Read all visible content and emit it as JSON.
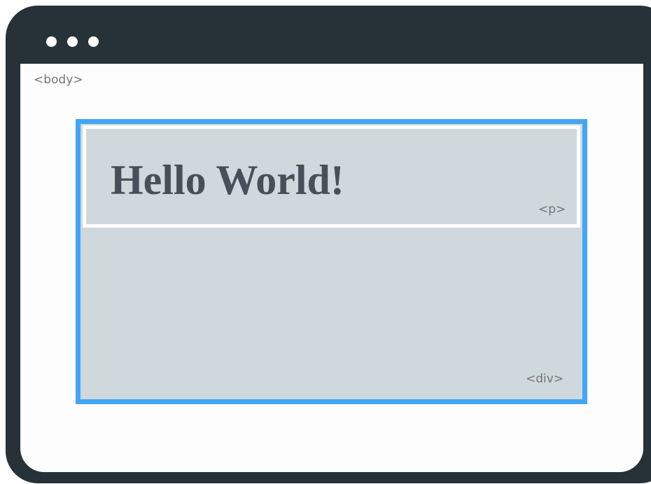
{
  "window": {
    "control_dots": 3
  },
  "tags": {
    "body": "<body>",
    "div": "<div>",
    "p": "<p>"
  },
  "paragraph": {
    "text": "Hello World!"
  },
  "colors": {
    "frame": "#263238",
    "div_border": "#42a5f5",
    "box_fill": "#cfd8dc",
    "tag_text": "#757575",
    "heading_text": "#455058"
  }
}
